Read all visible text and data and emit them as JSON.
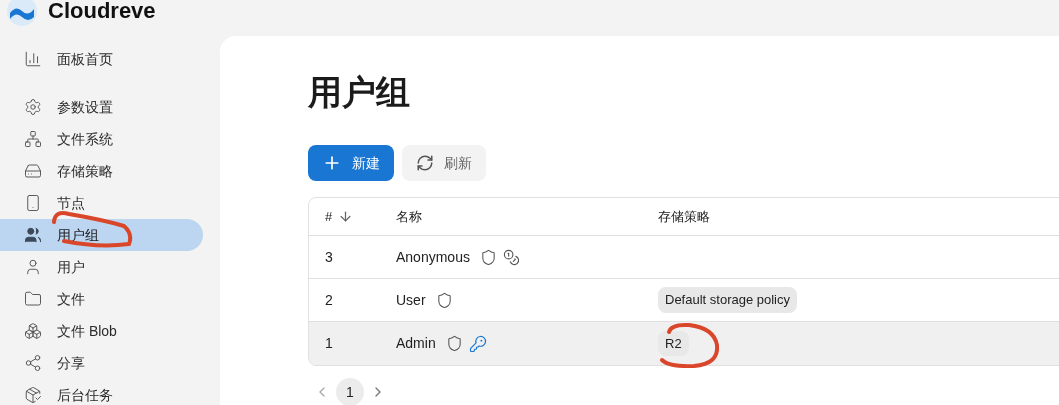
{
  "brand": {
    "name": "Cloudreve"
  },
  "sidebar": {
    "items": [
      {
        "label": "面板首页",
        "selected": false
      },
      {
        "label": "参数设置",
        "selected": false
      },
      {
        "label": "文件系统",
        "selected": false
      },
      {
        "label": "存储策略",
        "selected": false
      },
      {
        "label": "节点",
        "selected": false
      },
      {
        "label": "用户组",
        "selected": true
      },
      {
        "label": "用户",
        "selected": false
      },
      {
        "label": "文件",
        "selected": false
      },
      {
        "label": "文件 Blob",
        "selected": false
      },
      {
        "label": "分享",
        "selected": false
      },
      {
        "label": "后台任务",
        "selected": false
      }
    ]
  },
  "page": {
    "title": "用户组"
  },
  "buttons": [
    {
      "label": "新建",
      "kind": "primary"
    },
    {
      "label": "刷新",
      "kind": "secondary"
    }
  ],
  "table": {
    "columns": [
      "#",
      "名称",
      "存储策略"
    ],
    "rows": [
      {
        "id": "3",
        "name": "Anonymous",
        "kind": "guest",
        "hovered": false
      },
      {
        "id": "2",
        "name": "User",
        "kind": "user",
        "policy": "Default storage policy",
        "hovered": false
      },
      {
        "id": "1",
        "name": "Admin",
        "kind": "admin",
        "policy": "R2",
        "hovered": true
      }
    ]
  },
  "pagination": {
    "pages": [
      {
        "label": "1",
        "selected": true
      }
    ]
  }
}
